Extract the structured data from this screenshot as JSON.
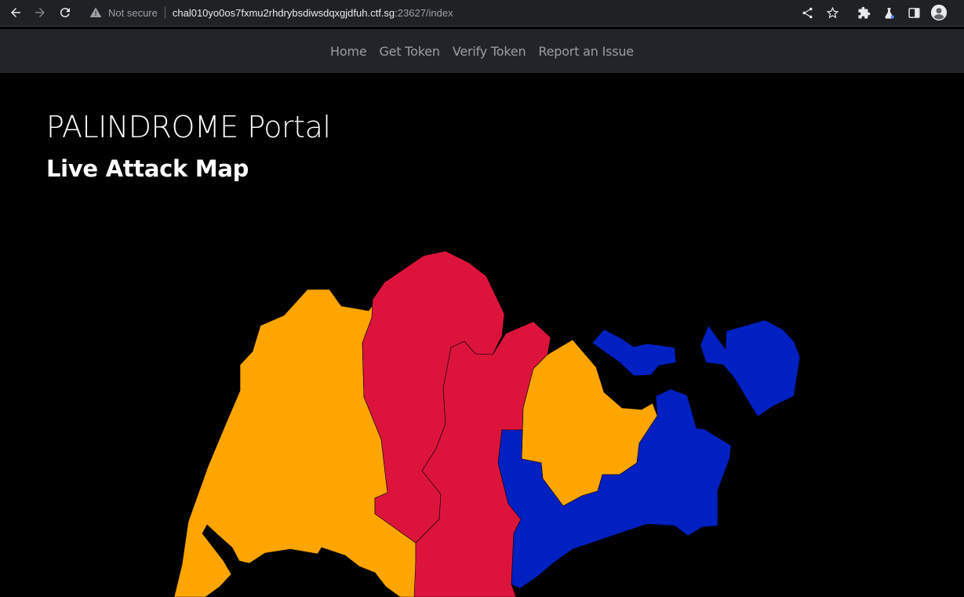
{
  "browser": {
    "security_label": "Not secure",
    "url_host": "chal010yo0os7fxmu2rhdrybsdiwsdqxgjdfuh.ctf.sg",
    "url_rest": ":23627/index",
    "icons": [
      "back-icon",
      "forward-icon",
      "reload-icon",
      "warning-icon",
      "share-icon",
      "star-icon",
      "extensions-icon",
      "labs-icon",
      "side-panel-icon",
      "profile-icon"
    ]
  },
  "navbar": {
    "items": [
      {
        "label": "Home"
      },
      {
        "label": "Get Token"
      },
      {
        "label": "Verify Token"
      },
      {
        "label": "Report an Issue"
      }
    ]
  },
  "main": {
    "title": "PALINDROME Portal",
    "subtitle": "Live Attack Map"
  },
  "map": {
    "colors": {
      "orange": "#FFA500",
      "red": "#DC143C",
      "blue": "#0020C2",
      "background": "#000000"
    }
  }
}
